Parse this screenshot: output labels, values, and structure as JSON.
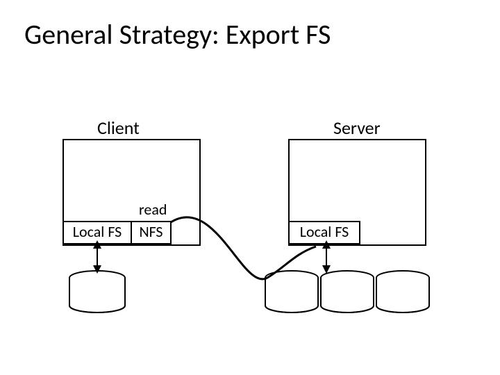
{
  "title": "General Strategy: Export FS",
  "client": {
    "label": "Client",
    "modules": {
      "local_fs": "Local FS",
      "nfs": "NFS"
    }
  },
  "server": {
    "label": "Server",
    "modules": {
      "local_fs": "Local FS"
    }
  },
  "annotation": {
    "read": "read"
  }
}
